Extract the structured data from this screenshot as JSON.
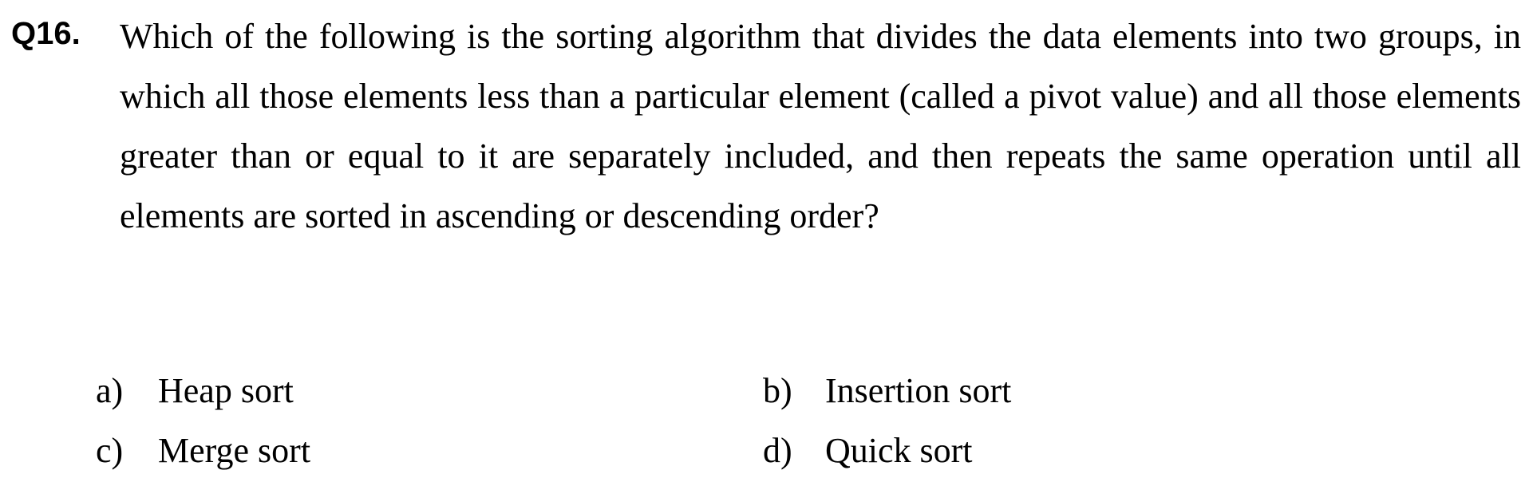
{
  "question": {
    "number": "Q16.",
    "text": "Which of the following is the sorting algorithm that divides the data elements into two groups, in which all those elements less than a particular element (called a pivot value) and all those elements greater than or equal to it are separately included, and then repeats the same operation until all elements are sorted in ascending or descending order?"
  },
  "options": [
    {
      "letter": "a)",
      "text": "Heap sort"
    },
    {
      "letter": "b)",
      "text": "Insertion sort"
    },
    {
      "letter": "c)",
      "text": "Merge sort"
    },
    {
      "letter": "d)",
      "text": "Quick sort"
    }
  ]
}
